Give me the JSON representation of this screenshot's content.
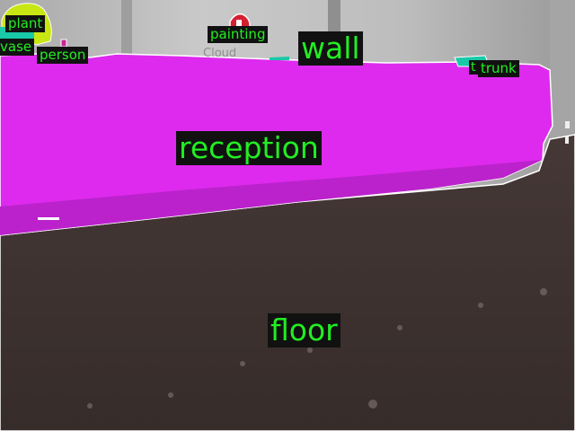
{
  "scene": {
    "sign_text": "Cloud",
    "colors": {
      "wall": "#bdbdbd",
      "floor": "#3a302e",
      "reception": "#dd2aee",
      "plant": "#c8e612",
      "vase": "#19c9a8",
      "painting_sign": "#d42030",
      "label_bg": "#111111",
      "label_text": "#22ee22",
      "outline": "#ffffff"
    }
  },
  "labels": {
    "plant": "plant",
    "vase": "vase",
    "person": "person",
    "painting": "painting",
    "wall": "wall",
    "t": "t",
    "trunk": "trunk",
    "reception": "reception",
    "floor": "floor"
  }
}
